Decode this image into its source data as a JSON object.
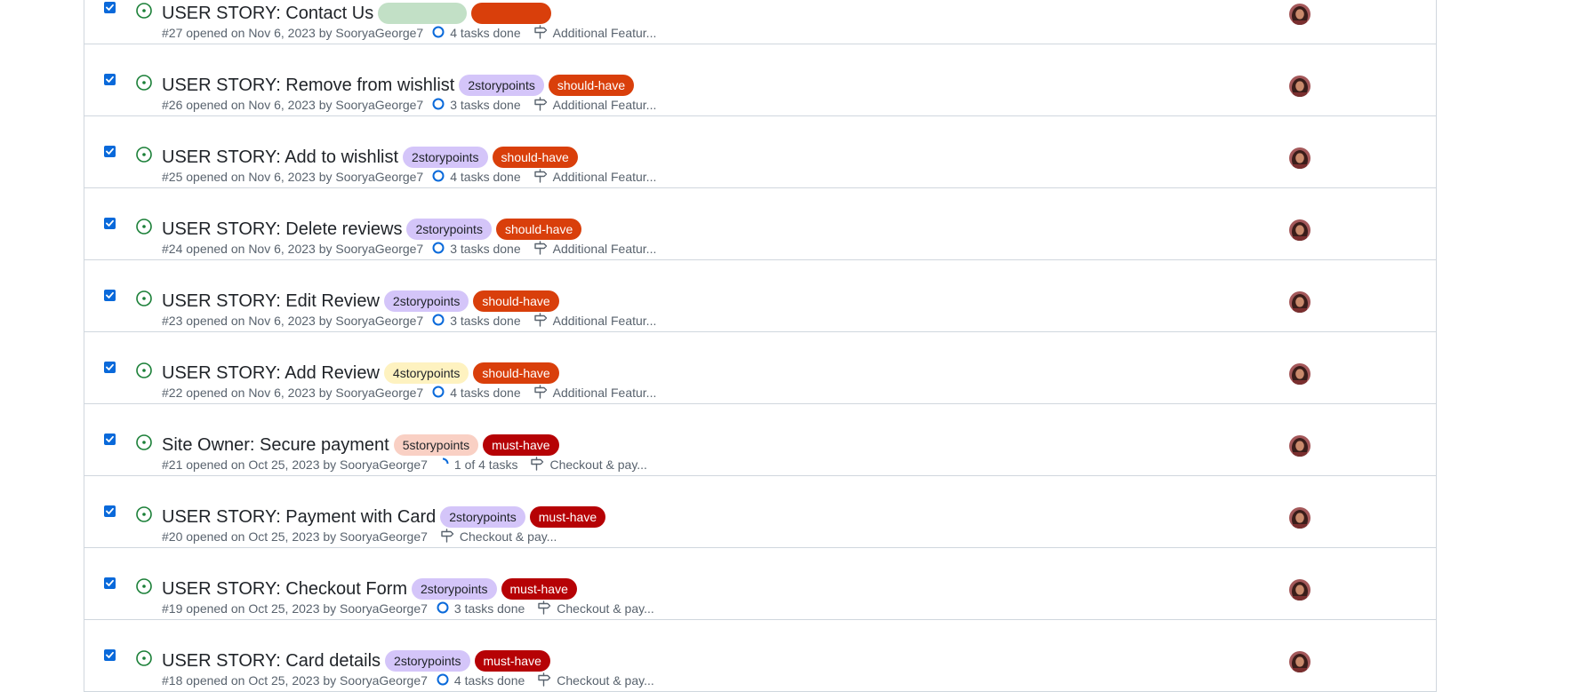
{
  "colors": {
    "accent": "#0969da",
    "open_green": "#1a7f37",
    "purple_label_bg": "#d4c5f9",
    "yellow_label_bg": "#fef2c0",
    "pink_label_bg": "#f9d0c4",
    "green_label_bg": "#c2e0c6",
    "should_have_bg": "#d93f0b",
    "must_have_bg": "#b60205"
  },
  "issues": [
    {
      "title": "USER STORY: Contact Us",
      "labels": [
        {
          "text": "",
          "bg": "#c2e0c6",
          "fg": "#1f2328"
        },
        {
          "text": "",
          "bg": "#d93f0b",
          "fg": "#ffffff"
        }
      ],
      "meta": "#27 opened on Nov 6, 2023 by SooryaGeorge7",
      "tasks": "4 tasks done",
      "tasks_progress": 1.0,
      "milestone": "Additional Featur..."
    },
    {
      "title": "USER STORY: Remove from wishlist",
      "labels": [
        {
          "text": "2storypoints",
          "bg": "#d4c5f9",
          "fg": "#1f2328"
        },
        {
          "text": "should-have",
          "bg": "#d93f0b",
          "fg": "#ffffff"
        }
      ],
      "meta": "#26 opened on Nov 6, 2023 by SooryaGeorge7",
      "tasks": "3 tasks done",
      "tasks_progress": 1.0,
      "milestone": "Additional Featur..."
    },
    {
      "title": "USER STORY: Add to wishlist",
      "labels": [
        {
          "text": "2storypoints",
          "bg": "#d4c5f9",
          "fg": "#1f2328"
        },
        {
          "text": "should-have",
          "bg": "#d93f0b",
          "fg": "#ffffff"
        }
      ],
      "meta": "#25 opened on Nov 6, 2023 by SooryaGeorge7",
      "tasks": "4 tasks done",
      "tasks_progress": 1.0,
      "milestone": "Additional Featur..."
    },
    {
      "title": "USER STORY: Delete reviews",
      "labels": [
        {
          "text": "2storypoints",
          "bg": "#d4c5f9",
          "fg": "#1f2328"
        },
        {
          "text": "should-have",
          "bg": "#d93f0b",
          "fg": "#ffffff"
        }
      ],
      "meta": "#24 opened on Nov 6, 2023 by SooryaGeorge7",
      "tasks": "3 tasks done",
      "tasks_progress": 1.0,
      "milestone": "Additional Featur..."
    },
    {
      "title": "USER STORY: Edit Review",
      "labels": [
        {
          "text": "2storypoints",
          "bg": "#d4c5f9",
          "fg": "#1f2328"
        },
        {
          "text": "should-have",
          "bg": "#d93f0b",
          "fg": "#ffffff"
        }
      ],
      "meta": "#23 opened on Nov 6, 2023 by SooryaGeorge7",
      "tasks": "3 tasks done",
      "tasks_progress": 1.0,
      "milestone": "Additional Featur..."
    },
    {
      "title": "USER STORY: Add Review",
      "labels": [
        {
          "text": "4storypoints",
          "bg": "#fef2c0",
          "fg": "#1f2328"
        },
        {
          "text": "should-have",
          "bg": "#d93f0b",
          "fg": "#ffffff"
        }
      ],
      "meta": "#22 opened on Nov 6, 2023 by SooryaGeorge7",
      "tasks": "4 tasks done",
      "tasks_progress": 1.0,
      "milestone": "Additional Featur..."
    },
    {
      "title": "Site Owner: Secure payment",
      "labels": [
        {
          "text": "5storypoints",
          "bg": "#f9d0c4",
          "fg": "#1f2328"
        },
        {
          "text": "must-have",
          "bg": "#b60205",
          "fg": "#ffffff"
        }
      ],
      "meta": "#21 opened on Oct 25, 2023 by SooryaGeorge7",
      "tasks": "1 of 4 tasks",
      "tasks_progress": 0.25,
      "milestone": "Checkout & pay..."
    },
    {
      "title": "USER STORY: Payment with Card",
      "labels": [
        {
          "text": "2storypoints",
          "bg": "#d4c5f9",
          "fg": "#1f2328"
        },
        {
          "text": "must-have",
          "bg": "#b60205",
          "fg": "#ffffff"
        }
      ],
      "meta": "#20 opened on Oct 25, 2023 by SooryaGeorge7",
      "tasks": "",
      "tasks_progress": null,
      "milestone": "Checkout & pay..."
    },
    {
      "title": "USER STORY: Checkout Form",
      "labels": [
        {
          "text": "2storypoints",
          "bg": "#d4c5f9",
          "fg": "#1f2328"
        },
        {
          "text": "must-have",
          "bg": "#b60205",
          "fg": "#ffffff"
        }
      ],
      "meta": "#19 opened on Oct 25, 2023 by SooryaGeorge7",
      "tasks": "3 tasks done",
      "tasks_progress": 1.0,
      "milestone": "Checkout & pay..."
    },
    {
      "title": "USER STORY: Card details",
      "labels": [
        {
          "text": "2storypoints",
          "bg": "#d4c5f9",
          "fg": "#1f2328"
        },
        {
          "text": "must-have",
          "bg": "#b60205",
          "fg": "#ffffff"
        }
      ],
      "meta": "#18 opened on Oct 25, 2023 by SooryaGeorge7",
      "tasks": "4 tasks done",
      "tasks_progress": 1.0,
      "milestone": "Checkout & pay..."
    }
  ]
}
